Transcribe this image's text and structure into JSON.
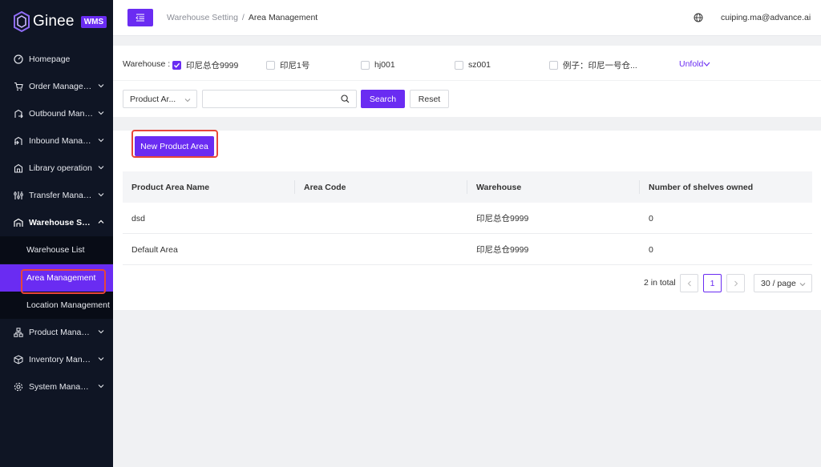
{
  "app": {
    "logo_text": "Ginee",
    "logo_badge": "WMS"
  },
  "sidebar": {
    "items": [
      {
        "label": "Homepage",
        "icon": "dashboard-icon",
        "expandable": false
      },
      {
        "label": "Order Management",
        "icon": "cart-icon",
        "expandable": true
      },
      {
        "label": "Outbound Management",
        "icon": "outbound-icon",
        "expandable": true
      },
      {
        "label": "Inbound Management",
        "icon": "inbound-icon",
        "expandable": true
      },
      {
        "label": "Library operation",
        "icon": "library-icon",
        "expandable": true
      },
      {
        "label": "Transfer Management",
        "icon": "transfer-icon",
        "expandable": true
      },
      {
        "label": "Warehouse Setting",
        "icon": "warehouse-icon",
        "expandable": true,
        "expanded": true
      },
      {
        "label": "Product Management",
        "icon": "product-icon",
        "expandable": true
      },
      {
        "label": "Inventory Management",
        "icon": "inventory-icon",
        "expandable": true
      },
      {
        "label": "System Management",
        "icon": "settings-icon",
        "expandable": true
      }
    ],
    "sub_items": [
      {
        "label": "Warehouse List",
        "selected": false
      },
      {
        "label": "Area Management",
        "selected": true
      },
      {
        "label": "Location Management",
        "selected": false
      }
    ]
  },
  "header": {
    "breadcrumb_parent": "Warehouse Setting",
    "breadcrumb_sep": "/",
    "breadcrumb_current": "Area Management",
    "user_email": "cuiping.ma@advance.ai"
  },
  "filter": {
    "warehouse_label": "Warehouse :",
    "warehouses": [
      {
        "label": "印尼总仓9999",
        "checked": true
      },
      {
        "label": "印尼1号",
        "checked": false
      },
      {
        "label": "hj001",
        "checked": false
      },
      {
        "label": "sz001",
        "checked": false
      },
      {
        "label": "例子：印尼一号仓...",
        "checked": false
      }
    ],
    "unfold_label": "Unfold",
    "field_select_value": "Product Ar...",
    "search_placeholder": "",
    "search_label": "Search",
    "reset_label": "Reset"
  },
  "toolbar": {
    "new_label": "New Product Area"
  },
  "table": {
    "columns": [
      "Product Area Name",
      "Area Code",
      "Warehouse",
      "Number of shelves owned"
    ],
    "rows": [
      [
        "dsd",
        "",
        "印尼总仓9999",
        "0"
      ],
      [
        "Default Area",
        "",
        "印尼总仓9999",
        "0"
      ]
    ]
  },
  "pagination": {
    "total_text": "2 in total",
    "current_page": "1",
    "page_size": "30 / page"
  },
  "colors": {
    "accent": "#6a2cf2",
    "sidebar_bg": "#0f1524",
    "highlight": "#e8463a"
  }
}
